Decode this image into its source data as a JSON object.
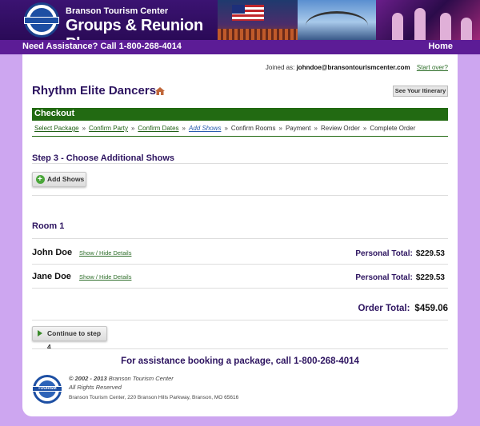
{
  "header": {
    "brand_small": "Branson Tourism Center",
    "brand_big": "Groups & Reunion Planner",
    "logo_text": "GROUPS",
    "assistance": "Need Assistance? Call 1-800-268-4014",
    "home_link": "Home"
  },
  "account": {
    "joined_prefix": "Joined as:",
    "email": "johndoe@bransontourismcenter.com",
    "start_over": "Start over?"
  },
  "package": {
    "title": "Rhythm Elite Dancers",
    "itinerary_button": "See Your Itinerary"
  },
  "checkout": {
    "heading": "Checkout",
    "steps": [
      {
        "label": "Select Package",
        "state": "done"
      },
      {
        "label": "Confirm Party",
        "state": "done"
      },
      {
        "label": "Confirm Dates",
        "state": "done"
      },
      {
        "label": "Add Shows",
        "state": "current"
      },
      {
        "label": "Confirm Rooms",
        "state": "todo"
      },
      {
        "label": "Payment",
        "state": "todo"
      },
      {
        "label": "Review Order",
        "state": "todo"
      },
      {
        "label": "Complete Order",
        "state": "todo"
      }
    ],
    "separator": "»"
  },
  "step": {
    "title": "Step 3 - Choose Additional Shows",
    "add_shows_button": "Add Shows"
  },
  "room": {
    "title": "Room 1",
    "details_link": "Show / Hide Details",
    "personal_total_label": "Personal Total:",
    "guests": [
      {
        "name": "John Doe",
        "total": "$229.53"
      },
      {
        "name": "Jane Doe",
        "total": "$229.53"
      }
    ]
  },
  "order": {
    "total_label": "Order Total:",
    "total": "$459.06",
    "continue_button": "Continue to step 4"
  },
  "footer": {
    "assistance": "For assistance booking a package, call 1-800-268-4014",
    "copyright_years": "© 2002 - 2013",
    "copyright_org": "Branson Tourism Center",
    "rights": "All Rights Reserved",
    "address": "Branson Tourism Center, 220 Branson Hills Parkway, Branson, MO 65616",
    "logo_text": "TOURISM"
  },
  "colors": {
    "brand_purple": "#5c1c96",
    "background": "#cda6f0",
    "checkout_green": "#226a12",
    "heading_navy": "#2d1460",
    "link_green": "#2e6e2a"
  }
}
